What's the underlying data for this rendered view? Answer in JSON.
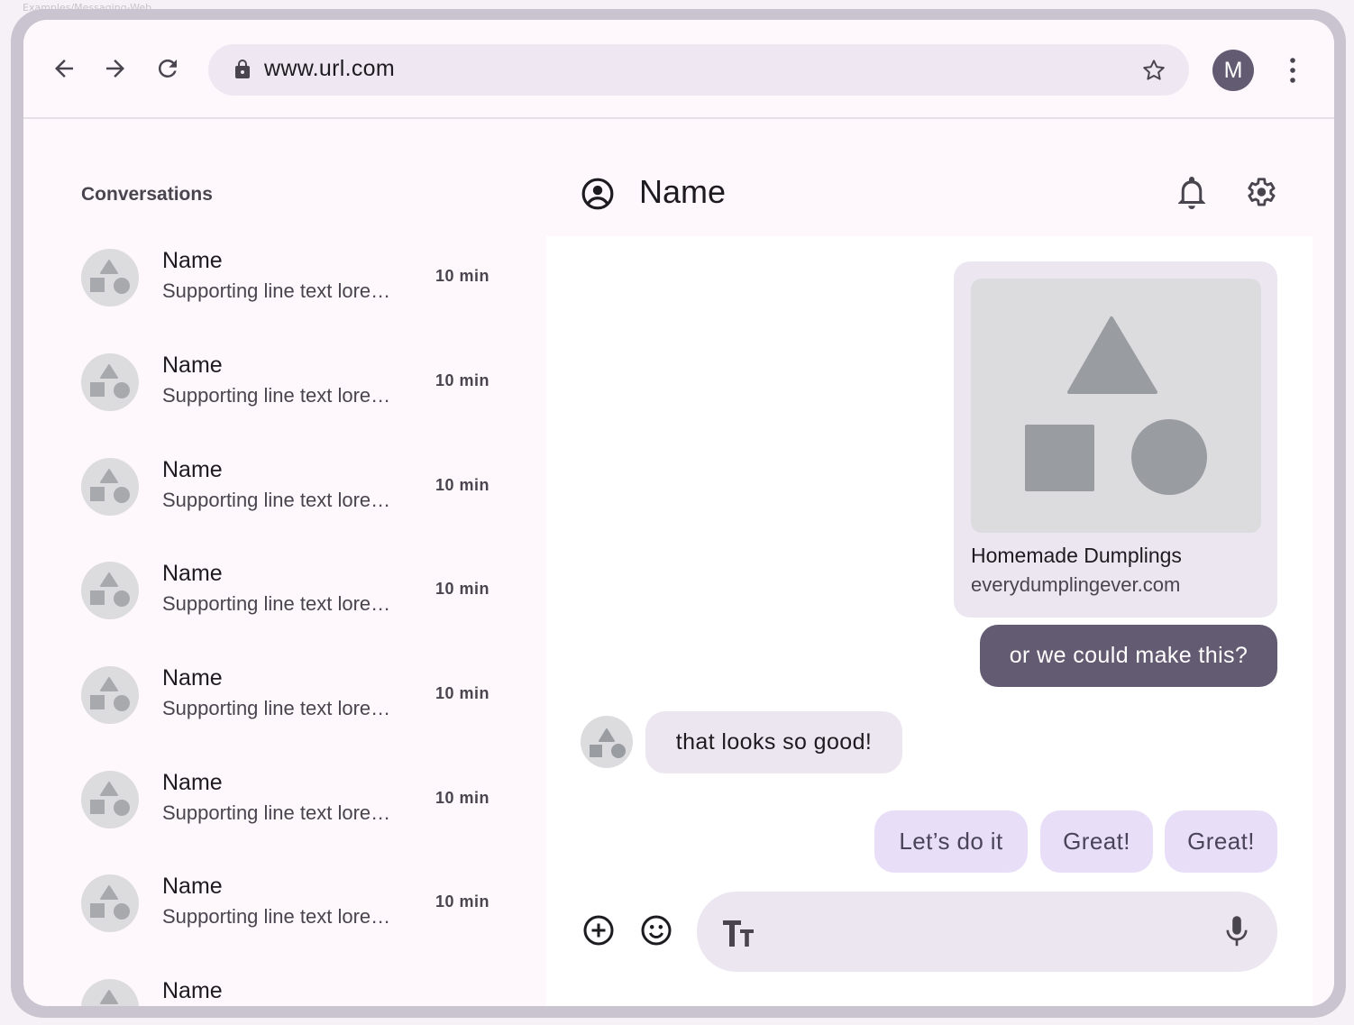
{
  "caption": "Examples/Messaging-Web",
  "browser": {
    "url": "www.url.com",
    "profile_initial": "M"
  },
  "sidebar": {
    "title": "Conversations",
    "conversations": [
      {
        "name": "Name",
        "supporting": "Supporting line text lore…",
        "time": "10 min"
      },
      {
        "name": "Name",
        "supporting": "Supporting line text lore…",
        "time": "10 min"
      },
      {
        "name": "Name",
        "supporting": "Supporting line text lore…",
        "time": "10 min"
      },
      {
        "name": "Name",
        "supporting": "Supporting line text lore…",
        "time": "10 min"
      },
      {
        "name": "Name",
        "supporting": "Supporting line text lore…",
        "time": "10 min"
      },
      {
        "name": "Name",
        "supporting": "Supporting line text lore…",
        "time": "10 min"
      },
      {
        "name": "Name",
        "supporting": "Supporting line text lore…",
        "time": "10 min"
      },
      {
        "name": "Name",
        "supporting": "",
        "time": ""
      }
    ]
  },
  "chat": {
    "title": "Name",
    "link_card": {
      "title": "Homemade Dumplings",
      "url": "everydumplingever.com"
    },
    "outgoing_message": "or we could make this?",
    "incoming_message": "that looks so good!",
    "suggestions": [
      "Let’s do it",
      "Great!",
      "Great!"
    ]
  },
  "icons": {
    "back": "arrow-back-icon",
    "forward": "arrow-forward-icon",
    "reload": "reload-icon",
    "lock": "lock-icon",
    "star": "star-icon",
    "more": "more-vert-icon",
    "account": "account-circle-icon",
    "bell": "bell-icon",
    "gear": "gear-icon",
    "add": "add-circle-icon",
    "emoji": "emoji-icon",
    "text_format": "text-format-icon",
    "mic": "mic-icon"
  },
  "colors": {
    "accent": "#625b71",
    "surface": "#fef7fc",
    "chip": "#e8def8",
    "bubble_in": "#ece6f0",
    "placeholder": "#dcdcdf"
  }
}
